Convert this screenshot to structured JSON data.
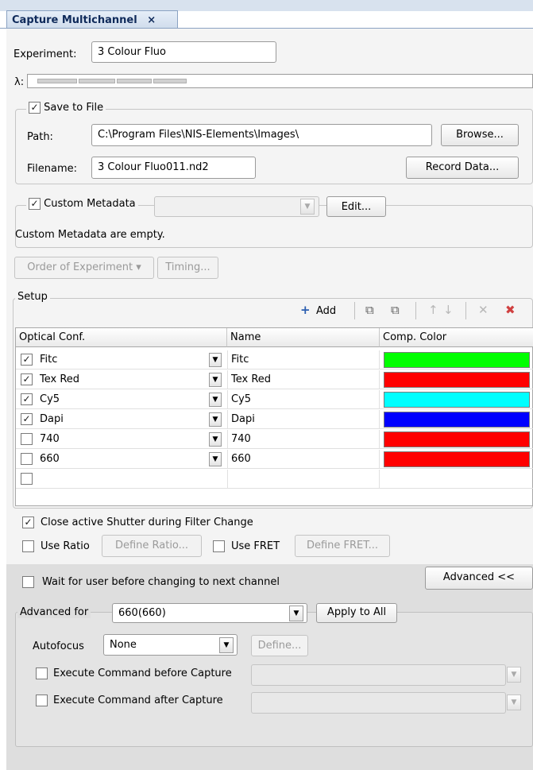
{
  "window": {
    "tab_title": "Capture Multichannel",
    "tab_close": "×"
  },
  "experiment": {
    "label": "Experiment:",
    "value": "3 Colour Fluo"
  },
  "lambda": {
    "label": "λ:"
  },
  "save_to_file": {
    "label": "Save to File",
    "checked": true,
    "path_label": "Path:",
    "path_value": "C:\\Program Files\\NIS-Elements\\Images\\",
    "browse_label": "Browse...",
    "filename_label": "Filename:",
    "filename_value": "3 Colour Fluo011.nd2",
    "record_label": "Record Data..."
  },
  "custom_metadata": {
    "label": "Custom Metadata",
    "checked": true,
    "edit_label": "Edit...",
    "status": "Custom Metadata are empty."
  },
  "order": {
    "order_label": "Order of Experiment ▾",
    "timing_label": "Timing..."
  },
  "setup": {
    "legend": "Setup",
    "add_label": "Add",
    "columns": [
      "Optical Conf.",
      "Name",
      "Comp. Color"
    ],
    "rows": [
      {
        "checked": true,
        "conf": "Fitc",
        "name": "Fitc",
        "color": "#00ff00"
      },
      {
        "checked": true,
        "conf": "Tex Red",
        "name": "Tex Red",
        "color": "#ff0000"
      },
      {
        "checked": true,
        "conf": "Cy5",
        "name": "Cy5",
        "color": "#00ffff"
      },
      {
        "checked": true,
        "conf": "Dapi",
        "name": "Dapi",
        "color": "#0000ff"
      },
      {
        "checked": false,
        "conf": "740",
        "name": "740",
        "color": "#ff0000"
      },
      {
        "checked": false,
        "conf": "660",
        "name": "660",
        "color": "#ff0000"
      }
    ]
  },
  "options": {
    "close_shutter_label": "Close active Shutter during Filter Change",
    "close_shutter_checked": true,
    "use_ratio_label": "Use Ratio",
    "define_ratio_label": "Define Ratio...",
    "use_fret_label": "Use FRET",
    "define_fret_label": "Define FRET..."
  },
  "advanced": {
    "wait_label": "Wait for user before changing to next channel",
    "advanced_button": "Advanced <<",
    "advanced_for_label": "Advanced for",
    "advanced_for_value": "660(660)",
    "apply_all_label": "Apply to All",
    "autofocus_label": "Autofocus",
    "autofocus_value": "None",
    "define_label": "Define...",
    "exec_before_label": "Execute Command before Capture",
    "exec_after_label": "Execute Command after Capture"
  },
  "icons": {
    "add": "+",
    "copy1": "⧉",
    "copy2": "⧉",
    "up": "↑",
    "down": "↓",
    "delete": "✕",
    "delete_all": "✖",
    "check": "✓",
    "dropdown": "▼"
  }
}
